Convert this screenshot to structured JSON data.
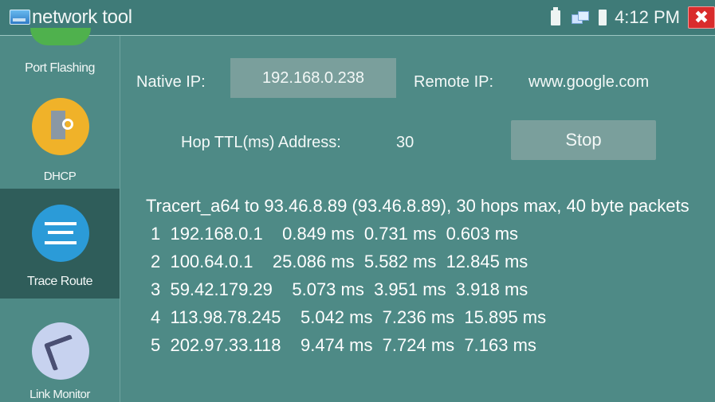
{
  "window": {
    "title": "network tool",
    "time": "4:12 PM",
    "close_glyph": "✖",
    "status_icons": [
      "usb-icon",
      "network-icon",
      "battery-icon"
    ]
  },
  "sidebar": {
    "items": [
      {
        "label": "Port Flashing",
        "icon": "port-flashing-icon",
        "selected": false
      },
      {
        "label": "DHCP",
        "icon": "dhcp-server-icon",
        "selected": false
      },
      {
        "label": "Trace Route",
        "icon": "trace-route-icon",
        "selected": true
      },
      {
        "label": "Link Monitor",
        "icon": "link-monitor-icon",
        "selected": false
      }
    ]
  },
  "form": {
    "native_ip_label": "Native IP:",
    "native_ip_value": "192.168.0.238",
    "remote_ip_label": "Remote IP:",
    "remote_ip_value": "www.google.com",
    "hop_label": "Hop TTL(ms) Address:",
    "hop_value": "30",
    "stop_button": "Stop"
  },
  "output": {
    "header": "Tracert_a64 to 93.46.8.89 (93.46.8.89), 30 hops max, 40 byte packets",
    "hops": [
      "1  192.168.0.1    0.849 ms  0.731 ms  0.603 ms",
      "2  100.64.0.1    25.086 ms  5.582 ms  12.845 ms",
      "3  59.42.179.29    5.073 ms  3.951 ms  3.918 ms",
      "4  113.98.78.245    5.042 ms  7.236 ms  15.895 ms",
      "5  202.97.33.118    9.474 ms  7.724 ms  7.163 ms"
    ]
  },
  "colors": {
    "background": "#4e8a86",
    "title_bar": "#3f7b78",
    "field": "#7a9f9c",
    "selected_nav": "#2f5d5a",
    "close": "#d92c2c"
  }
}
